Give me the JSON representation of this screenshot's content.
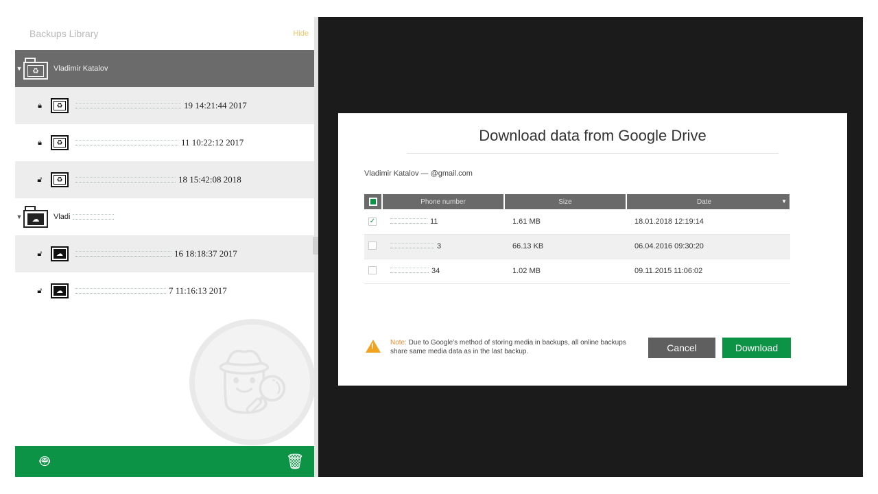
{
  "sidebar": {
    "title": "Backups Library",
    "hide_label": "Hide",
    "groups": [
      {
        "name": "Vladimir Katalov",
        "expanded": true,
        "selected": true,
        "items": [
          {
            "label": "19 14:21:44 2017",
            "lock": "closed"
          },
          {
            "label": "11 10:22:12 2017",
            "lock": "closed"
          },
          {
            "label": "18 15:42:08 2018",
            "lock": "open"
          }
        ]
      },
      {
        "name": "Vladi",
        "expanded": true,
        "selected": false,
        "items": [
          {
            "label": "16 18:18:37 2017",
            "lock": "open"
          },
          {
            "label": "7 11:16:13 2017",
            "lock": "open"
          }
        ]
      }
    ],
    "footer": {
      "icons": [
        "apple-icon",
        "android-icon"
      ],
      "trash": "trash-icon"
    }
  },
  "dialog": {
    "title": "Download data from Google Drive",
    "account": "Vladimir Katalov — @gmail.com",
    "columns": [
      "Phone number",
      "Size",
      "Date"
    ],
    "rows": [
      {
        "checked": true,
        "phone": "11",
        "size": "1.61 MB",
        "date": "18.01.2018 12:19:14"
      },
      {
        "checked": false,
        "phone": "3",
        "size": "66.13 KB",
        "date": "06.04.2016 09:30:20"
      },
      {
        "checked": false,
        "phone": "34",
        "size": "1.02 MB",
        "date": "09.11.2015 11:06:02"
      }
    ],
    "note_label": "Note:",
    "note_text": " Due to Google's method of storing media in backups, all online backups share same media data as in the last backup.",
    "cancel_label": "Cancel",
    "download_label": "Download"
  },
  "colors": {
    "accent": "#0d9345",
    "warning": "#f0a321",
    "dark_bg": "#1b1b1b"
  }
}
